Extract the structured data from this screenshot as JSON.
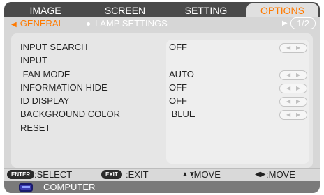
{
  "tabs": [
    {
      "label": "IMAGE"
    },
    {
      "label": "SCREEN"
    },
    {
      "label": "SETTING"
    },
    {
      "label": "OPTIONS"
    }
  ],
  "subnav": {
    "general": "GENERAL",
    "lamp": "LAMP SETTINGS",
    "page": "1/2"
  },
  "rows": [
    {
      "label": "INPUT SEARCH",
      "value": "OFF"
    },
    {
      "label": "INPUT",
      "value": ""
    },
    {
      "label": " FAN MODE",
      "value": "AUTO"
    },
    {
      "label": "INFORMATION HIDE",
      "value": "OFF"
    },
    {
      "label": "ID DISPLAY",
      "value": "OFF"
    },
    {
      "label": "BACKGROUND COLOR",
      "value": " BLUE"
    },
    {
      "label": "RESET",
      "value": ""
    }
  ],
  "footer": {
    "enter_pill": "ENTER",
    "select": ":SELECT",
    "exit_pill": "EXIT",
    "exit": ":EXIT",
    "move_ud": ":MOVE",
    "move_lr": ":MOVE"
  },
  "source": {
    "label": "COMPUTER"
  },
  "colors": {
    "accent": "#ff7a00",
    "tab_bar": "#4a4a4a",
    "panel": "#e6e6e6",
    "source_bar": "#7a7a7a"
  }
}
